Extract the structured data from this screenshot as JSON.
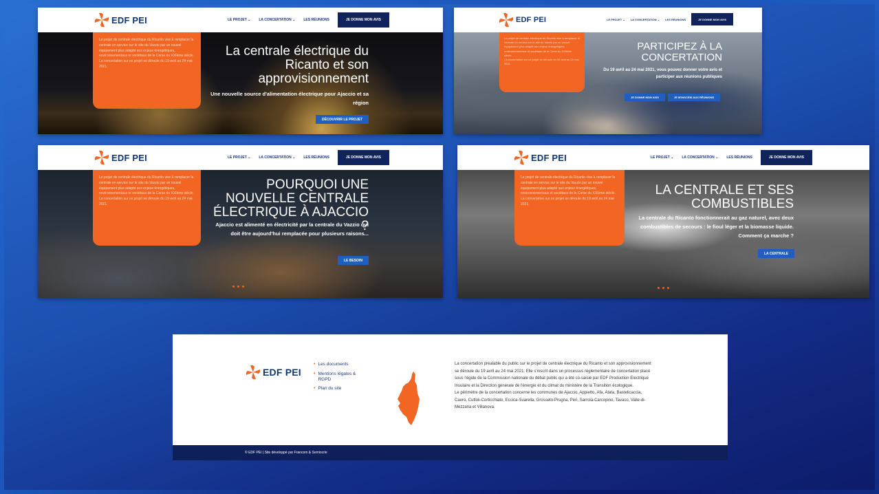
{
  "brand": {
    "name": "EDF PEI",
    "orange": "#f26522",
    "navy": "#10235c"
  },
  "nav": {
    "items": [
      "LE PROJET ⌄",
      "LA CONCERTATION ⌄",
      "LES RÉUNIONS"
    ],
    "cta": "JE DONNE MON AVIS"
  },
  "orange_panel": {
    "text": "Le projet de centrale électrique du Ricanto vise à remplacer la centrale en service sur le site du Vazzio par un nouvel équipement plus adapté aux enjeux énergétiques, environnementaux et sociétaux de la Corse du XXIème siècle.",
    "dates": "La concertation sur ce projet se déroule du 19 avril au 24 mai 2021."
  },
  "slides": [
    {
      "title": "La centrale électrique du Ricanto et son approvisionnement",
      "subtitle": "Une nouvelle source d'alimentation électrique pour Ajaccio et sa région",
      "button": "DÉCOUVRIR LE PROJET"
    },
    {
      "title": "PARTICIPEZ À LA CONCERTATION",
      "subtitle": "Du 19 avril au 24 mai 2021, vous pouvez donner votre avis et participer aux réunions publiques",
      "buttons": [
        "JE DONNE MON AVIS",
        "JE M'INSCRIS AUX RÉUNIONS"
      ]
    },
    {
      "title": "POURQUOI UNE NOUVELLE CENTRALE ÉLECTRIQUE À AJACCIO ?",
      "subtitle": "Ajaccio est alimenté en électricité par la centrale du Vazzio qui doit être aujourd'hui remplacée pour plusieurs raisons...",
      "button": "LE BESOIN"
    },
    {
      "title": "LA CENTRALE ET SES COMBUSTIBLES",
      "subtitle": "La centrale du Ricanto fonctionnerait au gaz naturel, avec deux combustibles de secours : le fioul léger et la biomasse liquide. Comment ça marche ?",
      "button": "LA CENTRALE"
    }
  ],
  "footer": {
    "links": [
      "Les documents",
      "Mentions légales & RGPD",
      "Plan du site"
    ],
    "text_1": "La concertation préalable du public sur le projet de centrale électrique du Ricanto et son approvisionnement se déroule du 19 avril au 24 mai 2021. Elle s'inscrit dans un processus réglementaire de concertation placé sous l'égide de la Commission nationale du débat public qui a été co-saisie par EDF Production Electrique Insulaire et la Direction générale de l'énergie et du climat du ministère de la Transition écologique.",
    "text_2": "Le périmètre de la concertation concerne les communes de Ajaccio, Appietto, Afa, Alata, Bastelicaccia, Cauro, Cuttoli-Corticchiato, Eccica-Suarella, Grosseto-Prugna, Peri, Sarrola-Carcopino, Tavaco, Valle-di-Mezzana et Villanova.",
    "credit": "© EDF PEI | Site développé par Francom & Semiocrie"
  }
}
